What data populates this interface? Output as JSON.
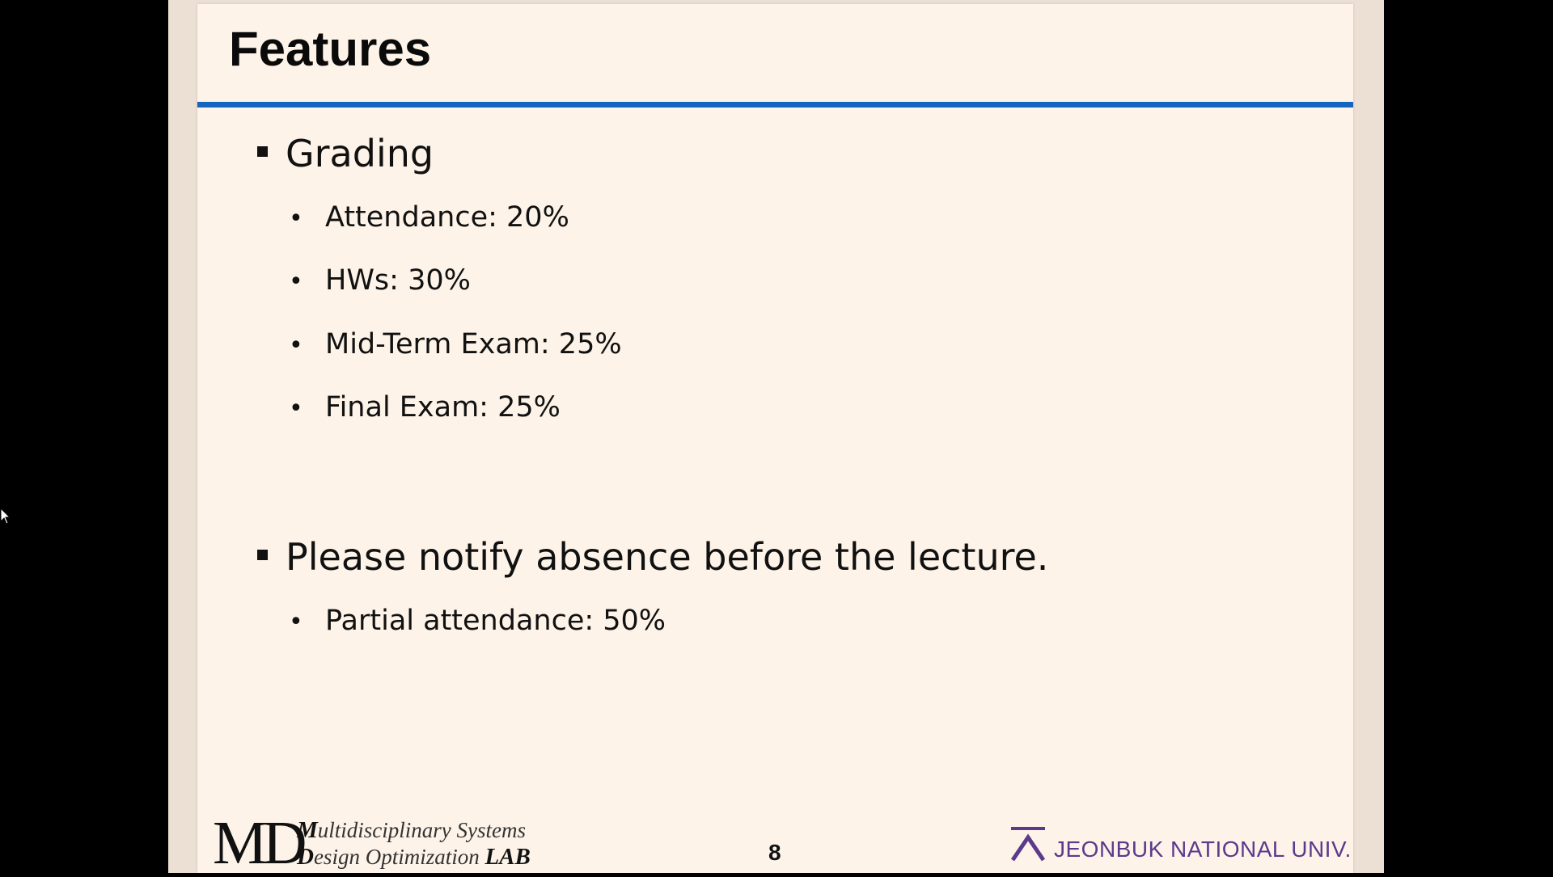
{
  "slide": {
    "title": "Features",
    "sections": [
      {
        "heading": "Grading",
        "items": [
          "Attendance: 20%",
          "HWs: 30%",
          "Mid-Term Exam: 25%",
          "Final Exam: 25%"
        ]
      },
      {
        "heading": "Please notify absence before the lecture.",
        "items": [
          "Partial attendance: 50%"
        ]
      }
    ],
    "page_number": "8"
  },
  "footer": {
    "lab_logo_letters": "MD",
    "lab_line1_initial": "M",
    "lab_line1_rest": "ultidisciplinary Systems",
    "lab_line2_initial": "D",
    "lab_line2_rest": "esign Optimization ",
    "lab_line2_bold": "LAB",
    "university": "JEONBUK NATIONAL UNIV."
  },
  "colors": {
    "slide_background": "#fdf3e8",
    "frame_background": "#ebe0d3",
    "title_rule": "#1565c0",
    "university_text": "#5b3a8c"
  },
  "icons": {
    "cursor": "mouse-pointer-icon",
    "university_mark": "jbnu-logo-icon"
  }
}
